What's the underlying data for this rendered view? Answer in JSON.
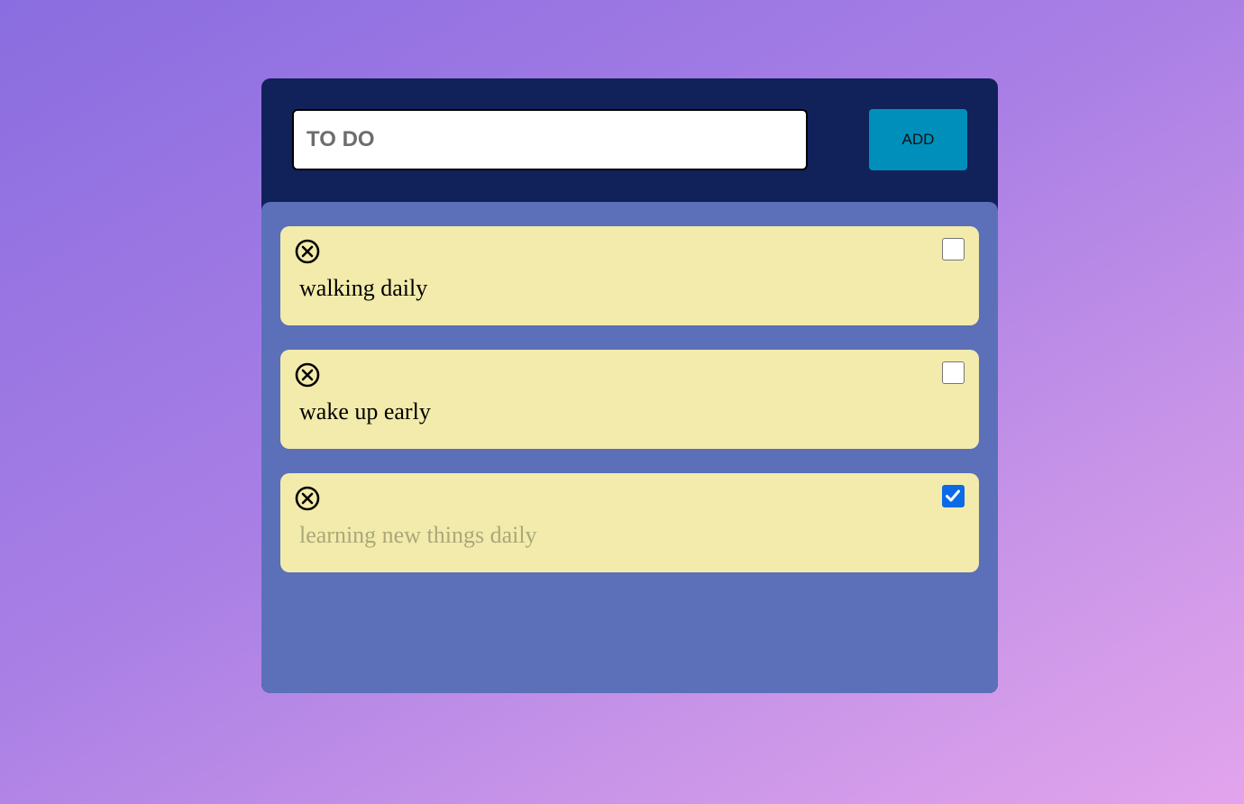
{
  "header": {
    "input_placeholder": "TO DO",
    "input_value": "",
    "add_label": "ADD"
  },
  "todos": [
    {
      "text": "walking daily",
      "done": false
    },
    {
      "text": "wake up early",
      "done": false
    },
    {
      "text": "learning new things daily",
      "done": true
    }
  ],
  "colors": {
    "app_background": "#112159",
    "list_background": "#5b70b8",
    "card_background": "#f3ebab",
    "add_button": "#008fbb",
    "checkbox_checked": "#0b6be6"
  },
  "icons": {
    "delete": "circle-x-icon",
    "checkmark": "checkmark-icon"
  }
}
